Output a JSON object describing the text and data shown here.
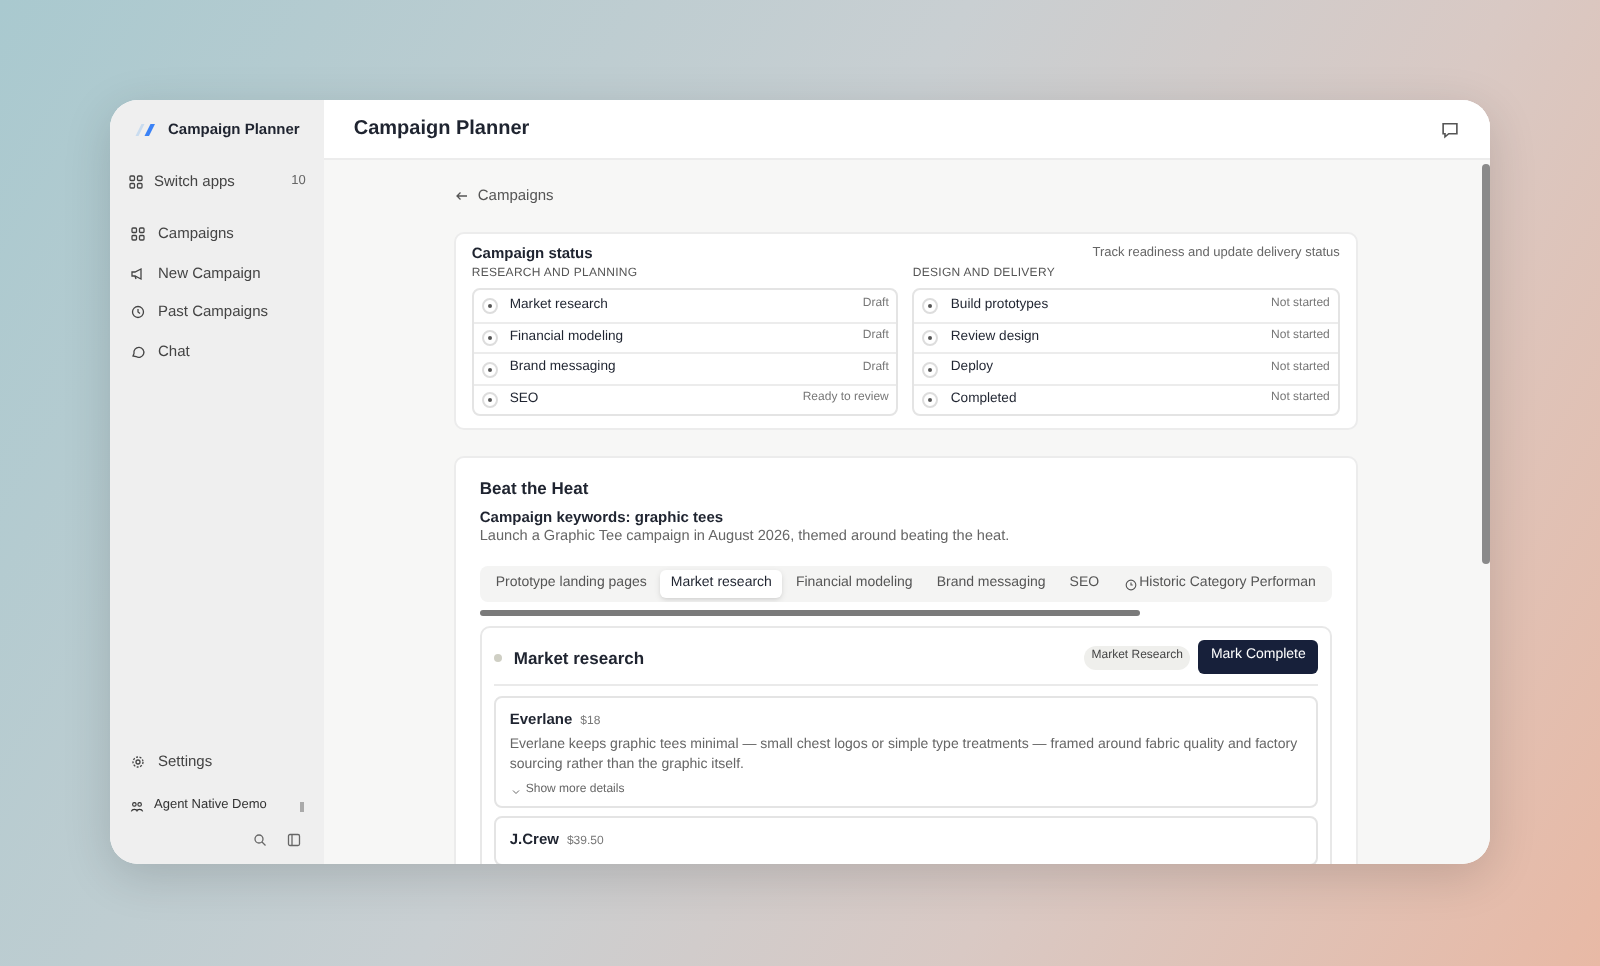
{
  "sidebar": {
    "app_name": "Campaign Planner",
    "switch_apps": {
      "label": "Switch apps",
      "count": "10"
    },
    "items": [
      {
        "label": "Campaigns"
      },
      {
        "label": "New Campaign"
      },
      {
        "label": "Past Campaigns"
      },
      {
        "label": "Chat"
      }
    ],
    "settings": "Settings",
    "workspace": "Agent Native Demo"
  },
  "header": {
    "title": "Campaign Planner"
  },
  "back_link": "Campaigns",
  "campaign_status": {
    "title": "Campaign status",
    "subtitle": "Track readiness and update delivery status",
    "groups": [
      {
        "heading": "RESEARCH AND PLANNING",
        "rows": [
          {
            "label": "Market research",
            "status": "Draft"
          },
          {
            "label": "Financial modeling",
            "status": "Draft"
          },
          {
            "label": "Brand messaging",
            "status": "Draft"
          },
          {
            "label": "SEO",
            "status": "Ready to review"
          }
        ]
      },
      {
        "heading": "DESIGN AND DELIVERY",
        "rows": [
          {
            "label": "Build prototypes",
            "status": "Not started"
          },
          {
            "label": "Review design",
            "status": "Not started"
          },
          {
            "label": "Deploy",
            "status": "Not started"
          },
          {
            "label": "Completed",
            "status": "Not started"
          }
        ]
      }
    ]
  },
  "campaign": {
    "title": "Beat the Heat",
    "keywords": "Campaign keywords: graphic tees",
    "description": "Launch a Graphic Tee campaign in August 2026, themed around beating the heat.",
    "tabs": [
      {
        "label": "Prototype landing pages",
        "selected": false,
        "kind": "plain"
      },
      {
        "label": "Market research",
        "selected": true,
        "kind": "plain"
      },
      {
        "label": "Financial modeling",
        "selected": false,
        "kind": "plain"
      },
      {
        "label": "Brand messaging",
        "selected": false,
        "kind": "plain"
      },
      {
        "label": "SEO",
        "selected": false,
        "kind": "plain"
      },
      {
        "label": "Historic Category Performan",
        "selected": false,
        "kind": "history"
      }
    ],
    "section": {
      "title": "Market research",
      "tag": "Market Research",
      "button": "Mark Complete",
      "items": [
        {
          "brand": "Everlane",
          "price": "$18",
          "text": "Everlane keeps graphic tees minimal — small chest logos or simple type treatments — framed around fabric quality and factory sourcing rather than the graphic itself.",
          "more": "Show more details"
        },
        {
          "brand": "J.Crew",
          "price": "$39.50"
        }
      ]
    }
  }
}
